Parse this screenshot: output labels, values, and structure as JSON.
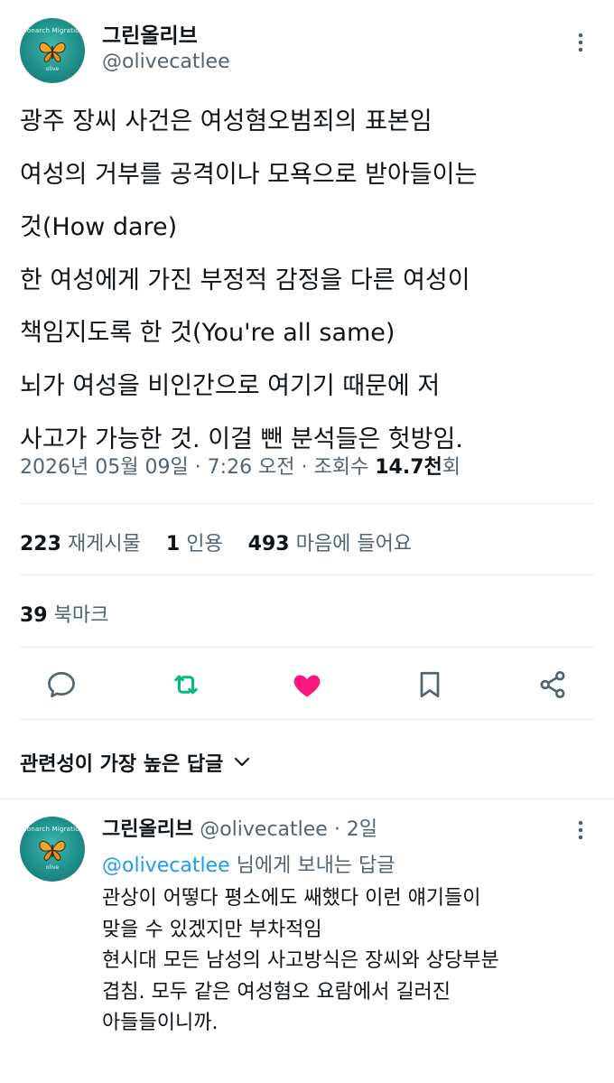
{
  "tweet": {
    "author_name": "그린올리브",
    "author_handle": "@olivecatlee",
    "avatar_text_top": "Monarch Migration",
    "avatar_text_bottom": "olive",
    "body_lines": [
      "광주 장씨 사건은 여성혐오범죄의 표본임",
      "여성의 거부를 공격이나 모욕으로 받아들이는",
      "것(How dare)",
      "한 여성에게 가진 부정적 감정을 다른 여성이",
      "책임지도록 한 것(You're all same)",
      "뇌가 여성을 비인간으로 여기기 때문에 저",
      "사고가 가능한 것. 이걸 뺀 분석들은 헛방임."
    ],
    "timestamp": "2026년 05월 09일 · 7:26 오전 · 조회수 ",
    "views_value": "14.7천",
    "views_suffix": "회"
  },
  "stats": {
    "reposts_count": "223",
    "reposts_label": "재게시물",
    "quotes_count": "1",
    "quotes_label": "인용",
    "likes_count": "493",
    "likes_label": "마음에 들어요",
    "bookmarks_count": "39",
    "bookmarks_label": "북마크"
  },
  "actions": {
    "reply_icon": "reply-icon",
    "repost_icon": "repost-icon",
    "like_icon": "heart-icon",
    "bookmark_icon": "bookmark-icon",
    "share_icon": "share-icon",
    "repost_color": "#00ba7c",
    "like_color": "#f91880"
  },
  "replies_sort": {
    "label": "관련성이 가장 높은 답글"
  },
  "reply": {
    "author_name": "그린올리브",
    "author_handle": "@olivecatlee · 2일",
    "reply_to_mention": "@olivecatlee",
    "reply_to_suffix": " 님에게 보내는 답글",
    "body_lines": [
      "관상이 어떻다 평소에도 쌔했다 이런 얘기들이",
      "맞을 수 있겠지만 부차적임",
      "현시대 모든 남성의 사고방식은 장씨와 상당부분",
      "겹침. 모두 같은 여성혐오 요람에서 길러진",
      "아들들이니까."
    ]
  },
  "colors": {
    "text": "#0f1419",
    "secondary": "#536471",
    "link": "#1d9bf0",
    "divider": "#e6e9ec"
  }
}
